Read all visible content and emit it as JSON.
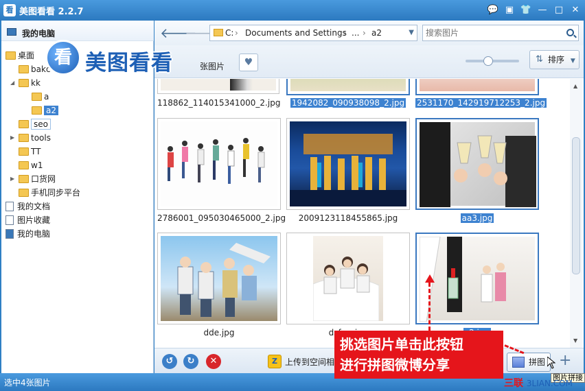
{
  "window": {
    "app_icon_char": "看",
    "title": "美图看看 2.2.7",
    "buttons": [
      "💬",
      "▣",
      "👕",
      "—",
      "□",
      "✕"
    ]
  },
  "sidebar": {
    "header": "我的电脑",
    "items": [
      {
        "label": "桌面",
        "indent": 0,
        "type": "folder"
      },
      {
        "label": "bakc",
        "indent": 1,
        "type": "folder"
      },
      {
        "label": "kk",
        "indent": 1,
        "type": "folder",
        "expanded": true
      },
      {
        "label": "a",
        "indent": 2,
        "type": "folder"
      },
      {
        "label": "a2",
        "indent": 2,
        "type": "folder",
        "selected": true
      },
      {
        "label": "seo",
        "indent": 1,
        "type": "folder",
        "hover": true
      },
      {
        "label": "tools",
        "indent": 1,
        "type": "folder"
      },
      {
        "label": "TT",
        "indent": 1,
        "type": "folder"
      },
      {
        "label": "w1",
        "indent": 1,
        "type": "folder"
      },
      {
        "label": "口货网",
        "indent": 1,
        "type": "folder"
      },
      {
        "label": "手机同步平台",
        "indent": 1,
        "type": "folder"
      },
      {
        "label": "我的文档",
        "indent": 0,
        "type": "doc"
      },
      {
        "label": "图片收藏",
        "indent": 0,
        "type": "doc"
      },
      {
        "label": "我的电脑",
        "indent": 0,
        "type": "pc"
      }
    ]
  },
  "logo": {
    "badge": "看",
    "text": "美图看看"
  },
  "toolbar": {
    "path": [
      "C:",
      "Documents and Settings",
      "...",
      "a2"
    ],
    "search_placeholder": "搜索图片",
    "count_text": "张图片",
    "sort_label": "排序",
    "zoom_level": 0.4
  },
  "grid": {
    "rows": [
      [
        {
          "name": "118862_114015341000_2.jpg",
          "selected": false
        },
        {
          "name": "1942082_090938098_2.jpg",
          "selected": true
        },
        {
          "name": "2531170_142919712253_2.jpg",
          "selected": true
        }
      ],
      [
        {
          "name": "2786001_095030465000_2.jpg",
          "selected": false
        },
        {
          "name": "2009123118455865.jpg",
          "selected": false
        },
        {
          "name": "aa3.jpg",
          "selected": true
        }
      ],
      [
        {
          "name": "dde.jpg",
          "selected": false
        },
        {
          "name": "dsfgw.jpg",
          "selected": false
        },
        {
          "name": "s2.jpg",
          "selected": true
        }
      ]
    ]
  },
  "bottombar": {
    "upload_label": "上传到空间相册",
    "puzzle_label": "拼图",
    "add_label": "+"
  },
  "status": {
    "text": "选中4张图片"
  },
  "callout": {
    "line1": "挑选图片单击此按钮",
    "line2": "进行拼图微博分享"
  },
  "tooltip": {
    "text": "图片拼接"
  },
  "watermark": {
    "brand": "三联",
    "domain": "3LIAN.COM"
  }
}
